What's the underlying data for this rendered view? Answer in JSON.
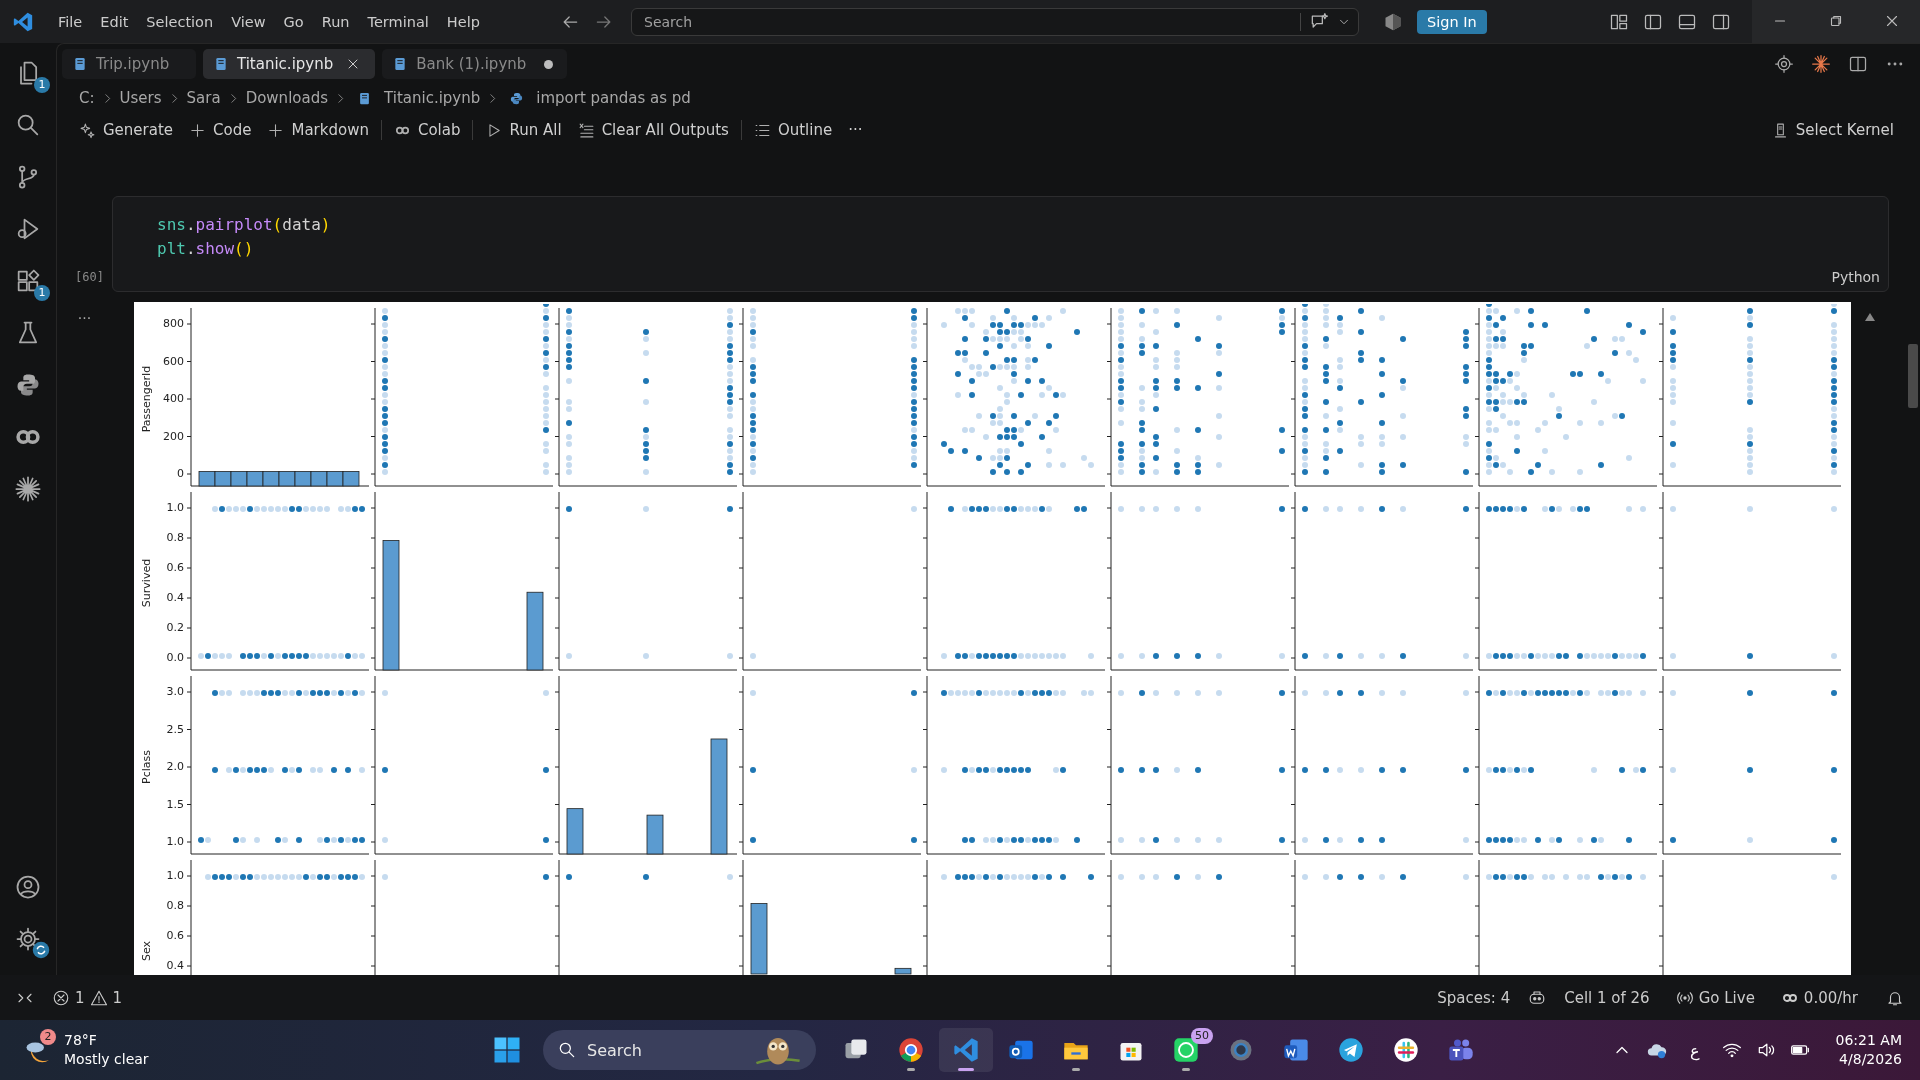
{
  "title_bar": {
    "menus": [
      "File",
      "Edit",
      "Selection",
      "View",
      "Go",
      "Run",
      "Terminal",
      "Help"
    ],
    "search": {
      "placeholder": "Search"
    },
    "sign_in": "Sign In"
  },
  "activity_bar": {
    "items": [
      {
        "kind": "files",
        "badge": "1"
      },
      {
        "kind": "search"
      },
      {
        "kind": "branch"
      },
      {
        "kind": "debug"
      },
      {
        "kind": "extensions",
        "badge": "1"
      },
      {
        "kind": "flask"
      },
      {
        "kind": "python"
      },
      {
        "kind": "colab"
      },
      {
        "kind": "asterisk"
      }
    ],
    "bottom": [
      {
        "kind": "account"
      },
      {
        "kind": "settings_sync"
      }
    ]
  },
  "tabs": [
    {
      "label": "Trip.ipynb",
      "selected": false,
      "modified": false
    },
    {
      "label": "Titanic.ipynb",
      "selected": true,
      "modified": false
    },
    {
      "label": "Bank (1).ipynb",
      "selected": false,
      "modified": true
    }
  ],
  "breadcrumbs": [
    {
      "label": "C:",
      "kind": "folder"
    },
    {
      "label": "Users",
      "kind": "folder"
    },
    {
      "label": "Sara",
      "kind": "folder"
    },
    {
      "label": "Downloads",
      "kind": "folder"
    },
    {
      "label": "Titanic.ipynb",
      "kind": "notebook"
    },
    {
      "label": "import pandas as pd",
      "kind": "python"
    }
  ],
  "toolbar": [
    {
      "kind": "sparkle",
      "label": "Generate"
    },
    {
      "kind": "plus",
      "label": "Code"
    },
    {
      "kind": "plus",
      "label": "Markdown"
    },
    {
      "kind": "separator"
    },
    {
      "kind": "colab",
      "label": "Colab"
    },
    {
      "kind": "separator"
    },
    {
      "kind": "run",
      "label": "Run All"
    },
    {
      "kind": "clear",
      "label": "Clear All Outputs"
    },
    {
      "kind": "separator"
    },
    {
      "kind": "outline",
      "label": "Outline"
    },
    {
      "kind": "more",
      "label": "···"
    }
  ],
  "kernel": "Select Kernel",
  "cell": {
    "count": "[60]",
    "language": "Python",
    "lines": [
      [
        {
          "t": "sns",
          "kind": "module"
        },
        {
          "t": ".",
          "kind": "punct"
        },
        {
          "t": "pairplot",
          "kind": "func"
        },
        {
          "t": "(",
          "kind": "paren"
        },
        {
          "t": "data",
          "kind": "var"
        },
        {
          "t": ")",
          "kind": "paren"
        }
      ],
      [
        {
          "t": "plt",
          "kind": "module"
        },
        {
          "t": ".",
          "kind": "punct"
        },
        {
          "t": "show",
          "kind": "func"
        },
        {
          "t": "()",
          "kind": "paren"
        }
      ]
    ]
  },
  "output": {
    "more": "...",
    "columns": [
      {
        "kind": "continuous"
      },
      {
        "kind": "binary"
      },
      {
        "kind": "three"
      },
      {
        "kind": "binary"
      },
      {
        "kind": "cloud"
      },
      {
        "kind": "count"
      },
      {
        "kind": "count"
      },
      {
        "kind": "skewed"
      },
      {
        "kind": "three"
      }
    ],
    "rows": [
      {
        "label": "PassengerId",
        "kind": "continuous",
        "ticks": [
          "800",
          "600",
          "400",
          "200",
          "0"
        ]
      },
      {
        "label": "Survived",
        "kind": "binary",
        "ticks": [
          "1.0",
          "0.8",
          "0.6",
          "0.4",
          "0.2",
          "0.0"
        ]
      },
      {
        "label": "Pclass",
        "kind": "three",
        "ticks": [
          "3.0",
          "2.5",
          "2.0",
          "1.5",
          "1.0"
        ]
      },
      {
        "label": "Sex",
        "kind": "binary",
        "ticks": [
          "1.0",
          "0.8",
          "0.6",
          "0.4"
        ]
      }
    ]
  },
  "status_bar": {
    "errors": "1",
    "warnings": "1",
    "items": [
      {
        "kind": "text",
        "label": "Spaces: 4"
      },
      {
        "kind": "copilot"
      },
      {
        "kind": "text",
        "label": "Cell 1 of 26"
      },
      {
        "kind": "broadcast",
        "label": "Go Live"
      },
      {
        "kind": "colab",
        "label": "0.00/hr"
      },
      {
        "kind": "bell"
      }
    ]
  },
  "taskbar": {
    "weather": {
      "temp": "78°F",
      "text": "Mostly clear",
      "badge": "2"
    },
    "search": {
      "placeholder": "Search"
    },
    "apps": [
      {
        "kind": "taskview",
        "running": false,
        "selected": false
      },
      {
        "kind": "browser",
        "running": true,
        "selected": false
      },
      {
        "kind": "editor",
        "running": true,
        "selected": true
      },
      {
        "kind": "mail",
        "running": false,
        "selected": false
      },
      {
        "kind": "folder",
        "running": true,
        "selected": false
      },
      {
        "kind": "store",
        "running": false,
        "selected": false
      },
      {
        "kind": "chat",
        "running": true,
        "selected": false,
        "badge": "50"
      },
      {
        "kind": "settings",
        "running": false,
        "selected": false
      },
      {
        "kind": "word",
        "running": false,
        "selected": false
      },
      {
        "kind": "telegram",
        "running": false,
        "selected": false
      },
      {
        "kind": "slack",
        "running": false,
        "selected": false
      },
      {
        "kind": "teams",
        "running": false,
        "selected": false
      }
    ],
    "tray": {
      "language": "ع",
      "time": "06:21 AM",
      "date": "4/8/2026"
    }
  }
}
